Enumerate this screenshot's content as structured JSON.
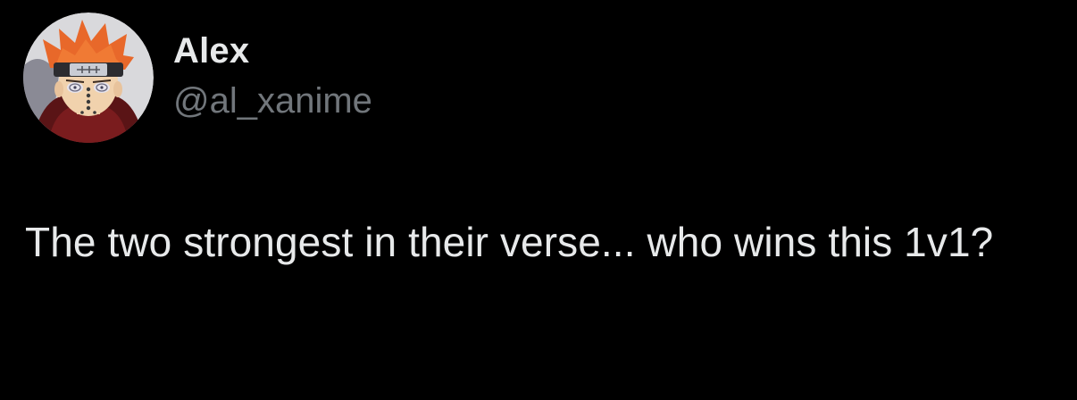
{
  "author": {
    "display_name": "Alex",
    "handle": "@al_xanime",
    "avatar_icon": "anime-character-avatar-icon"
  },
  "tweet": {
    "text": "The two strongest in their verse... who wins this 1v1?"
  },
  "colors": {
    "background": "#000000",
    "primary_text": "#e7e9ea",
    "secondary_text": "#71767b"
  }
}
